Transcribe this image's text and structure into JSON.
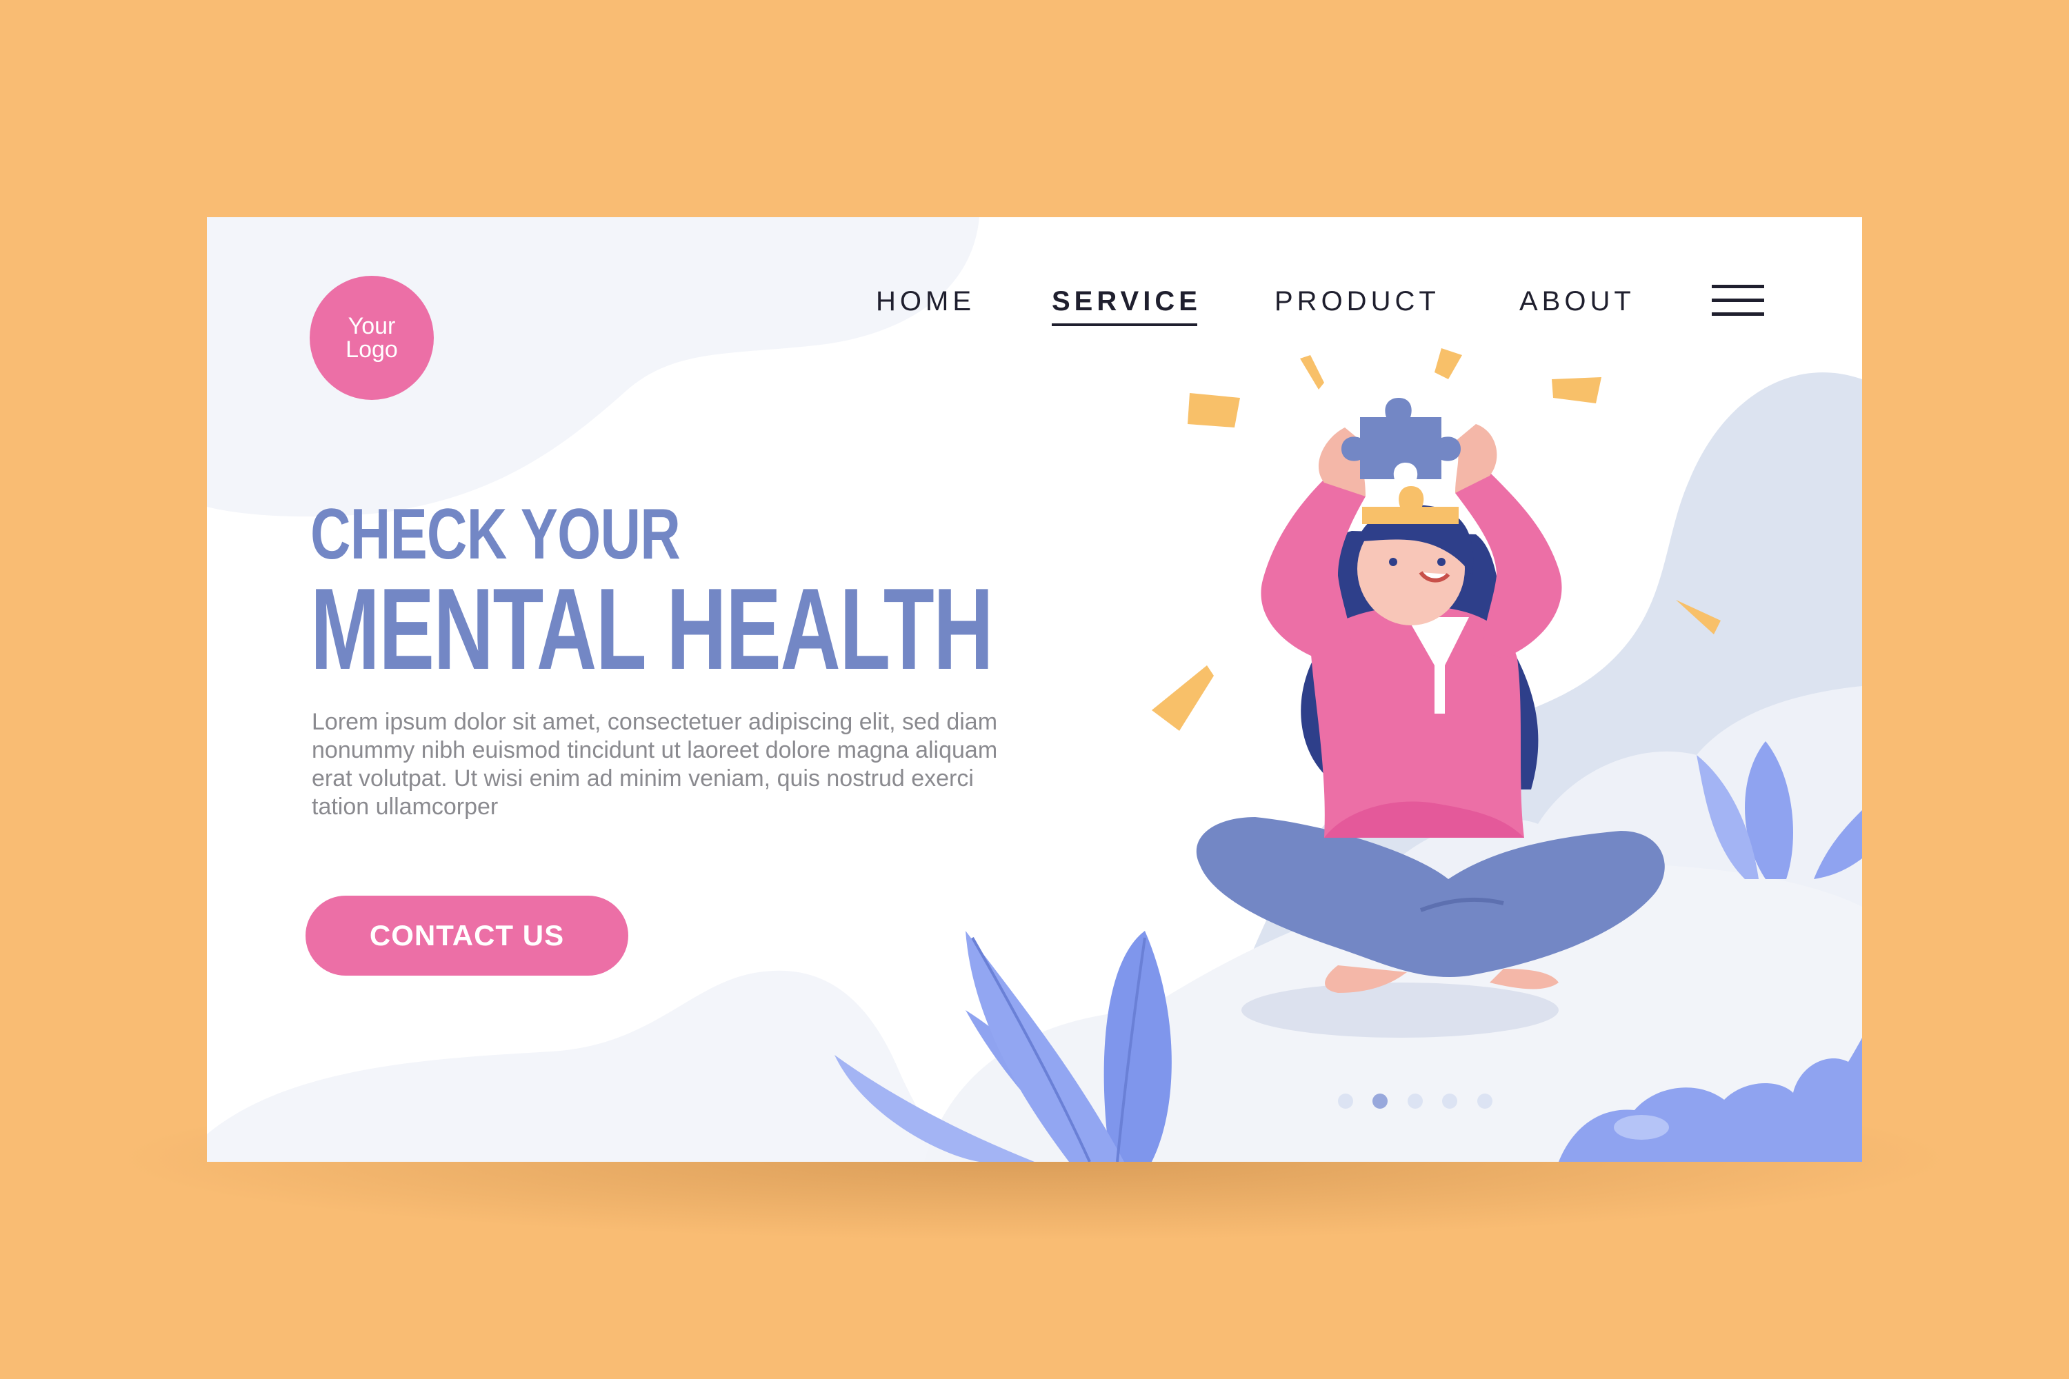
{
  "brand": {
    "logo_line1": "Your",
    "logo_line2": "Logo"
  },
  "nav": {
    "items": [
      {
        "label": "HOME",
        "active": false
      },
      {
        "label": "SERVICE",
        "active": true
      },
      {
        "label": "PRODUCT",
        "active": false
      },
      {
        "label": "ABOUT",
        "active": false
      }
    ],
    "menu_icon": "hamburger-menu-icon"
  },
  "hero": {
    "headline_line1": "CHECK YOUR",
    "headline_line2": "MENTAL HEALTH",
    "body": "Lorem ipsum dolor sit amet, consectetuer adipiscing elit, sed diam nonummy nibh euismod tincidunt ut laoreet dolore magna aliquam erat volutpat. Ut wisi enim ad minim veniam, quis nostrud exerci tation ullamcorper",
    "cta_label": "CONTACT US"
  },
  "illustration": {
    "subject": "woman sitting cross-legged holding a puzzle piece above her head",
    "icons": [
      "puzzle-piece-icon",
      "leaf-icon",
      "sparkle-icon"
    ]
  },
  "carousel": {
    "total": 5,
    "active_index": 1
  },
  "colors": {
    "page_background": "#F9BC73",
    "card_background": "#FFFFFF",
    "accent_pink": "#EC6FA6",
    "headline_blue": "#7387C5",
    "leaf_blue": "#8FA3F0",
    "text_gray": "#8A8A8F",
    "nav_text": "#1F1F2E"
  }
}
